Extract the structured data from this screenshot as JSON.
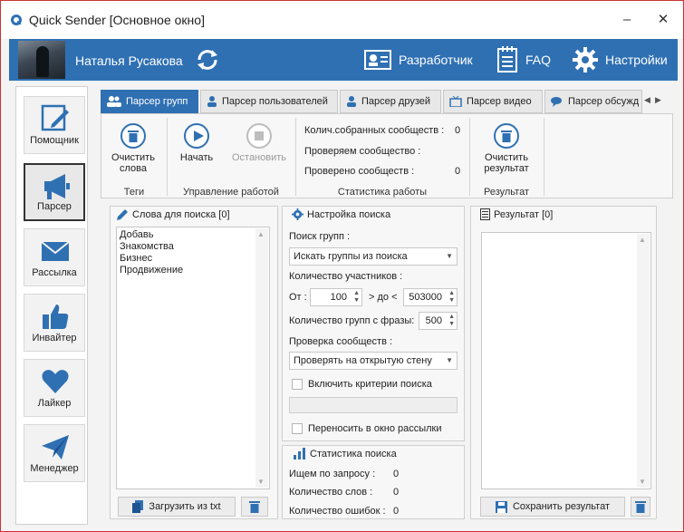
{
  "window": {
    "title": "Quick Sender [Основное окно]",
    "minimize": "–",
    "close": "✕"
  },
  "header": {
    "user_name": "Наталья Русакова",
    "developer_label": "Разработчик",
    "faq_label": "FAQ",
    "settings_label": "Настройки",
    "accent": "#2f70b3"
  },
  "sidebar": {
    "items": [
      {
        "label": "Помощник",
        "icon": "pencil-icon"
      },
      {
        "label": "Парсер",
        "icon": "megaphone-icon"
      },
      {
        "label": "Рассылка",
        "icon": "envelope-icon"
      },
      {
        "label": "Инвайтер",
        "icon": "thumbs-up-icon"
      },
      {
        "label": "Лайкер",
        "icon": "heart-icon"
      },
      {
        "label": "Менеджер",
        "icon": "paper-plane-icon"
      }
    ]
  },
  "tabs": [
    {
      "label": "Парсер групп"
    },
    {
      "label": "Парсер пользователей"
    },
    {
      "label": "Парсер друзей"
    },
    {
      "label": "Парсер видео"
    },
    {
      "label": "Парсер обсужд"
    }
  ],
  "ribbon": {
    "clear_words_line1": "Очистить",
    "clear_words_line2": "слова",
    "tags_label": "Теги",
    "start_label": "Начать",
    "stop_label": "Остановить",
    "control_label": "Управление работой",
    "stat_collected_label": "Колич.собранных сообществ :",
    "stat_collected_value": "0",
    "stat_checking_label": "Проверяем сообщество :",
    "stat_checked_label": "Проверено сообществ :",
    "stat_checked_value": "0",
    "work_stats_label": "Статистика работы",
    "clear_result_line1": "Очистить",
    "clear_result_line2": "результат",
    "result_group_label": "Результат"
  },
  "keywords_panel": {
    "title": "Слова для поиска [0]",
    "keywords": [
      "Добавь",
      "Знакомства",
      "Бизнес",
      "Продвижение"
    ],
    "load_button": "Загрузить из txt"
  },
  "search_settings": {
    "title": "Настройка поиска",
    "group_search_label": "Поиск групп :",
    "group_search_value": "Искать группы из поиска",
    "members_label": "Количество участников :",
    "from_label": "От :",
    "from_value": "100",
    "to_label": "> до <",
    "to_value": "503000",
    "groups_per_phrase_label": "Количество групп с фразы:",
    "groups_per_phrase_value": "500",
    "community_check_label": "Проверка сообществ :",
    "community_check_value": "Проверять на открытую стену",
    "enable_criteria_label": "Включить критерии поиска",
    "move_to_mailing_label": "Переносить в окно рассылки"
  },
  "search_stats": {
    "title": "Статистика поиска",
    "found_label": "Ищем по запросу :",
    "found_value": "0",
    "words_label": "Количество слов :",
    "words_value": "0",
    "errors_label": "Количество ошибок :",
    "errors_value": "0"
  },
  "result_panel": {
    "title": "Результат [0]",
    "save_button": "Сохранить результат"
  }
}
